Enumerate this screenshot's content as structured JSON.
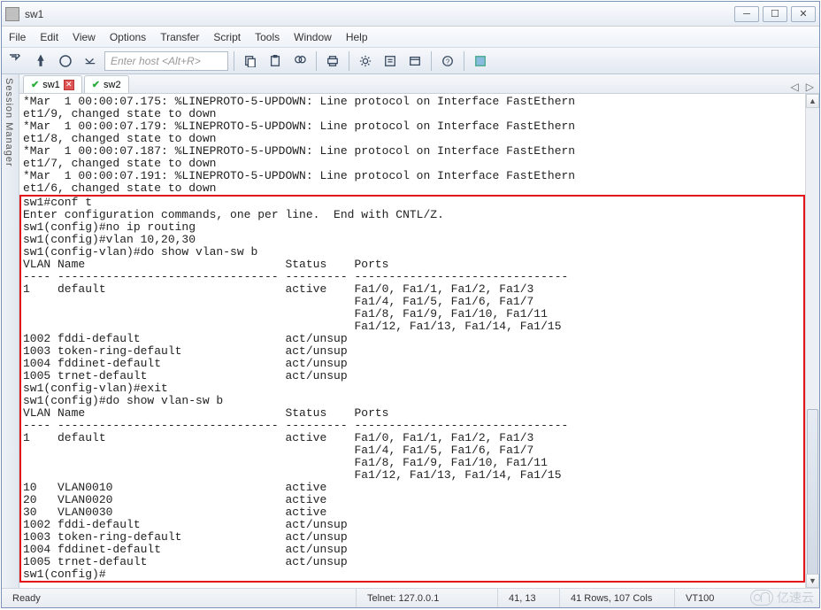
{
  "window": {
    "title": "sw1"
  },
  "menu": {
    "file": "File",
    "edit": "Edit",
    "view": "View",
    "options": "Options",
    "transfer": "Transfer",
    "script": "Script",
    "tools": "Tools",
    "window": "Window",
    "help": "Help"
  },
  "toolbar": {
    "host_placeholder": "Enter host <Alt+R>"
  },
  "sidebar": {
    "label": "Session Manager"
  },
  "tabs": [
    {
      "label": "sw1",
      "active": true,
      "closable": true
    },
    {
      "label": "sw2",
      "active": false,
      "closable": false
    }
  ],
  "terminal": {
    "top_lines": [
      "*Mar  1 00:00:07.175: %LINEPROTO-5-UPDOWN: Line protocol on Interface FastEthern",
      "et1/9, changed state to down",
      "*Mar  1 00:00:07.179: %LINEPROTO-5-UPDOWN: Line protocol on Interface FastEthern",
      "et1/8, changed state to down",
      "*Mar  1 00:00:07.187: %LINEPROTO-5-UPDOWN: Line protocol on Interface FastEthern",
      "et1/7, changed state to down",
      "*Mar  1 00:00:07.191: %LINEPROTO-5-UPDOWN: Line protocol on Interface FastEthern",
      "et1/6, changed state to down"
    ],
    "box_lines": [
      "sw1#conf t",
      "Enter configuration commands, one per line.  End with CNTL/Z.",
      "sw1(config)#no ip routing",
      "sw1(config)#vlan 10,20,30",
      "sw1(config-vlan)#do show vlan-sw b",
      "",
      "VLAN Name                             Status    Ports",
      "---- -------------------------------- --------- -------------------------------",
      "1    default                          active    Fa1/0, Fa1/1, Fa1/2, Fa1/3",
      "                                                Fa1/4, Fa1/5, Fa1/6, Fa1/7",
      "                                                Fa1/8, Fa1/9, Fa1/10, Fa1/11",
      "                                                Fa1/12, Fa1/13, Fa1/14, Fa1/15",
      "1002 fddi-default                     act/unsup",
      "1003 token-ring-default               act/unsup",
      "1004 fddinet-default                  act/unsup",
      "1005 trnet-default                    act/unsup",
      "sw1(config-vlan)#exit",
      "sw1(config)#do show vlan-sw b",
      "",
      "VLAN Name                             Status    Ports",
      "---- -------------------------------- --------- -------------------------------",
      "1    default                          active    Fa1/0, Fa1/1, Fa1/2, Fa1/3",
      "                                                Fa1/4, Fa1/5, Fa1/6, Fa1/7",
      "                                                Fa1/8, Fa1/9, Fa1/10, Fa1/11",
      "                                                Fa1/12, Fa1/13, Fa1/14, Fa1/15",
      "10   VLAN0010                         active",
      "20   VLAN0020                         active",
      "30   VLAN0030                         active",
      "1002 fddi-default                     act/unsup",
      "1003 token-ring-default               act/unsup",
      "1004 fddinet-default                  act/unsup",
      "1005 trnet-default                    act/unsup",
      "sw1(config)#"
    ]
  },
  "status": {
    "ready": "Ready",
    "connection": "Telnet: 127.0.0.1",
    "cursor": "41,  13",
    "size": "41 Rows, 107 Cols",
    "emulation": "VT100"
  },
  "watermark": "亿速云"
}
